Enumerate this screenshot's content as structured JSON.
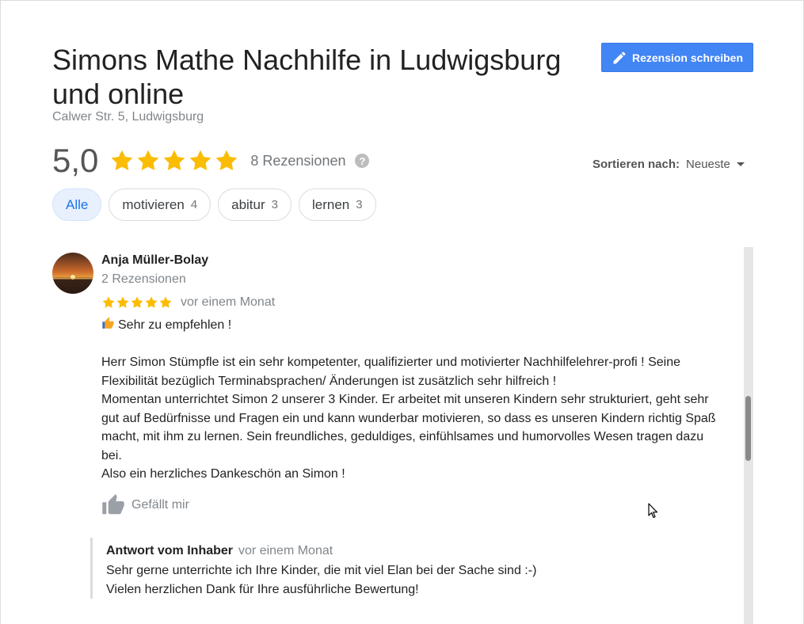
{
  "header": {
    "title": "Simons Mathe Nachhilfe in Ludwigsburg und online",
    "address": "Calwer Str. 5, Ludwigsburg",
    "write_review_label": "Rezension schreiben"
  },
  "summary": {
    "rating": "5,0",
    "stars": 5,
    "review_count_label": "8 Rezensionen",
    "help_symbol": "?"
  },
  "sort": {
    "label": "Sortieren nach:",
    "value": "Neueste"
  },
  "chips": [
    {
      "label": "Alle",
      "count": ""
    },
    {
      "label": "motivieren",
      "count": "4"
    },
    {
      "label": "abitur",
      "count": "3"
    },
    {
      "label": "lernen",
      "count": "3"
    }
  ],
  "review": {
    "author": "Anja Müller-Bolay",
    "author_meta": "2 Rezensionen",
    "stars": 5,
    "date": "vor einem Monat",
    "headline": "Sehr zu empfehlen !",
    "paragraphs": [
      "Herr Simon Stümpfle ist ein sehr kompetenter, qualifizierter und motivierter Nachhilfelehrer-profi ! Seine Flexibilität bezüglich Terminabsprachen/ Änderungen ist zusätzlich  sehr hilfreich !",
      "Momentan unterrichtet Simon 2 unserer 3 Kinder. Er arbeitet mit unseren Kindern sehr strukturiert, geht sehr gut auf Bedürfnisse und Fragen ein und kann wunderbar motivieren, so dass es unseren Kindern richtig Spaß macht, mit ihm zu lernen. Sein freundliches, geduldiges, einfühlsames und humorvolles Wesen tragen dazu bei.",
      "Also ein herzliches Dankeschön an Simon !"
    ],
    "like_label": "Gefällt mir"
  },
  "owner_reply": {
    "label": "Antwort vom Inhaber",
    "date": "vor einem Monat",
    "lines": [
      "Sehr gerne unterrichte ich Ihre Kinder, die mit viel Elan bei der Sache sind :-)",
      "Vielen herzlichen Dank für Ihre ausführliche Bewertung!"
    ]
  },
  "colors": {
    "star": "#fbbc04",
    "accent": "#4285f4",
    "chip_active_bg": "#e8f0fe",
    "chip_active_text": "#1a73e8"
  },
  "icons": {
    "write": "pencil-icon",
    "help": "help-icon",
    "sort": "caret-down-icon",
    "like": "thumbs-up-icon",
    "headline": "thumbs-up-emoji"
  }
}
